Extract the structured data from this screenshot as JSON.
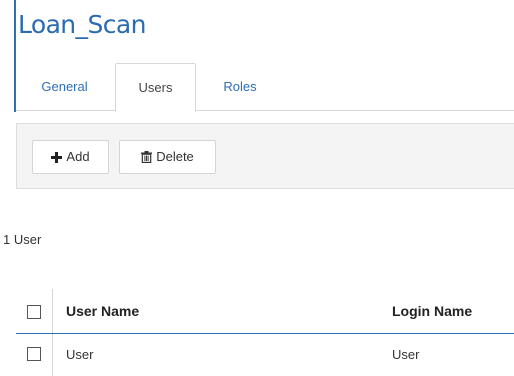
{
  "app": {
    "title": "Loan_Scan"
  },
  "tabs": [
    {
      "label": "General",
      "active": false
    },
    {
      "label": "Users",
      "active": true
    },
    {
      "label": "Roles",
      "active": false
    }
  ],
  "toolbar": {
    "add_label": "Add",
    "add_icon": "plus-icon",
    "delete_label": "Delete",
    "delete_icon": "trash-icon"
  },
  "users": {
    "count_text": "1 User",
    "columns": [
      "User Name",
      "Login Name"
    ],
    "rows": [
      {
        "user_name": "User",
        "login_name": "User",
        "selected": false
      }
    ]
  },
  "colors": {
    "accent": "#2f6fb5",
    "toolbar_bg": "#f4f4f4",
    "border": "#d7d7d7"
  }
}
